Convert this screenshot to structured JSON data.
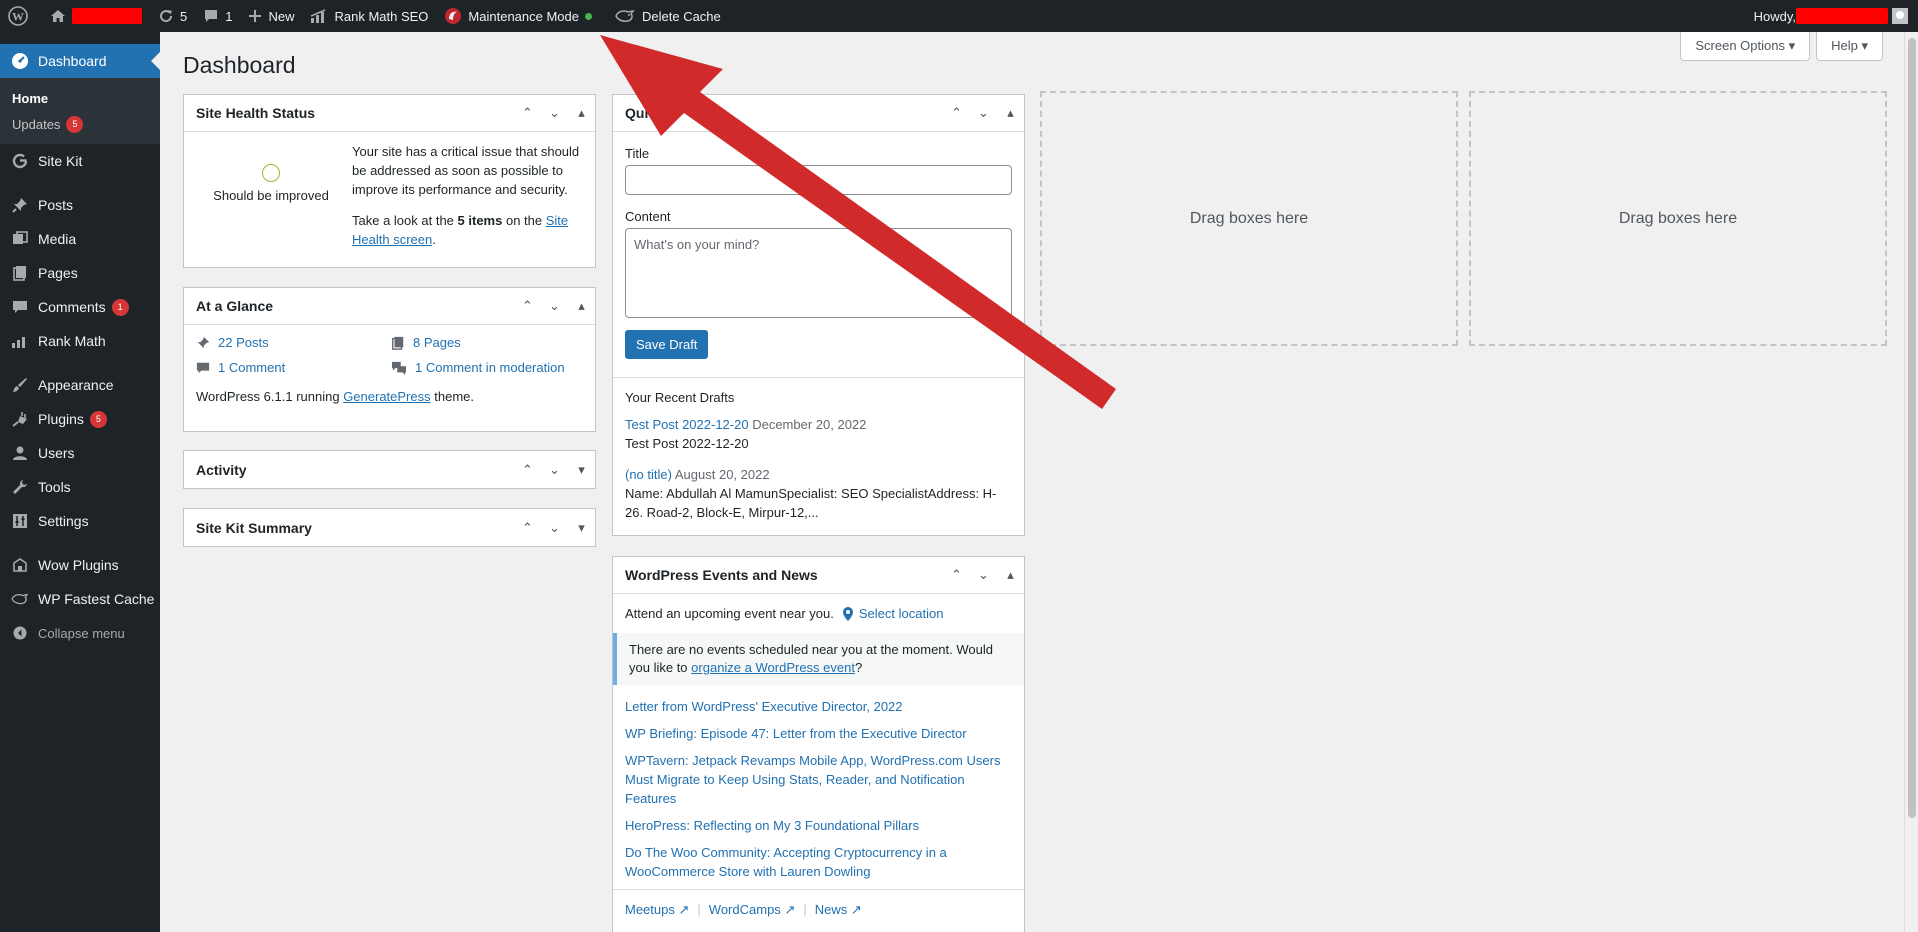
{
  "adminbar": {
    "updates_count": "5",
    "comments_count": "1",
    "new_label": "New",
    "rank_math_label": "Rank Math SEO",
    "maintenance_label": "Maintenance Mode",
    "delete_cache_label": "Delete Cache",
    "howdy_label": "Howdy,"
  },
  "sidebar": {
    "dashboard_label": "Dashboard",
    "home_label": "Home",
    "updates_label": "Updates",
    "updates_badge": "5",
    "items": [
      {
        "label": "Site Kit",
        "icon": "google-g-icon"
      },
      {
        "label": "Posts",
        "icon": "pushpin-icon"
      },
      {
        "label": "Media",
        "icon": "media-icon"
      },
      {
        "label": "Pages",
        "icon": "pages-icon"
      },
      {
        "label": "Comments",
        "icon": "comment-icon",
        "badge": "1"
      },
      {
        "label": "Rank Math",
        "icon": "chart-icon"
      },
      {
        "label": "Appearance",
        "icon": "brush-icon"
      },
      {
        "label": "Plugins",
        "icon": "plug-icon",
        "badge": "5"
      },
      {
        "label": "Users",
        "icon": "user-icon"
      },
      {
        "label": "Tools",
        "icon": "wrench-icon"
      },
      {
        "label": "Settings",
        "icon": "settings-icon"
      },
      {
        "label": "Wow Plugins",
        "icon": "wow-icon"
      },
      {
        "label": "WP Fastest Cache",
        "icon": "cheetah-icon"
      }
    ],
    "collapse_label": "Collapse menu"
  },
  "header": {
    "title": "Dashboard",
    "screen_options": "Screen Options ▾",
    "help": "Help ▾"
  },
  "site_health": {
    "title": "Site Health Status",
    "status": "Should be improved",
    "text1": "Your site has a critical issue that should be addressed as soon as possible to improve its performance and security.",
    "text2_pre": "Take a look at the",
    "text2_bold": "5 items",
    "text2_mid": "on the",
    "text2_link": "Site Health screen",
    "text2_post": "."
  },
  "at_a_glance": {
    "title": "At a Glance",
    "posts": "22 Posts",
    "pages": "8 Pages",
    "comments": "1 Comment",
    "moderation": "1 Comment in moderation",
    "footer_pre": "WordPress 6.1.1 running",
    "theme_link": "GeneratePress",
    "footer_post": "theme."
  },
  "activity": {
    "title": "Activity"
  },
  "site_kit_summary": {
    "title": "Site Kit Summary"
  },
  "quick_draft": {
    "title": "Quick",
    "title_label": "Title",
    "content_label": "Content",
    "content_placeholder": "What's on your mind?",
    "save_label": "Save Draft",
    "recent_title": "Your Recent Drafts",
    "drafts": [
      {
        "link": "Test Post 2022-12-20",
        "date": "December 20, 2022",
        "excerpt": "Test Post 2022-12-20"
      },
      {
        "link": "(no title)",
        "date": "August 20, 2022",
        "excerpt": "Name: Abdullah Al MamunSpecialist: SEO SpecialistAddress: H-26. Road-2, Block-E, Mirpur-12,..."
      }
    ]
  },
  "events": {
    "title": "WordPress Events and News",
    "attend_text": "Attend an upcoming event near you.",
    "select_location": "Select location",
    "notice_pre": "There are no events scheduled near you at the moment. Would you like to",
    "notice_link": "organize a WordPress event",
    "notice_post": "?",
    "news": [
      "Letter from WordPress' Executive Director, 2022",
      "WP Briefing: Episode 47: Letter from the Executive Director",
      "WPTavern: Jetpack Revamps Mobile App, WordPress.com Users Must Migrate to Keep Using Stats, Reader, and Notification Features",
      "HeroPress: Reflecting on My 3 Foundational Pillars",
      "Do The Woo Community: Accepting Cryptocurrency in a WooCommerce Store with Lauren Dowling"
    ],
    "meetups": "Meetups",
    "wordcamps": "WordCamps",
    "news_link": "News"
  },
  "drop_zone_label": "Drag boxes here",
  "colors": {
    "adminbar": "#1d2327",
    "accent": "#2271b1",
    "badge": "#d63638",
    "annotation_arrow": "#d12a2a",
    "redaction": "#ff0000"
  }
}
